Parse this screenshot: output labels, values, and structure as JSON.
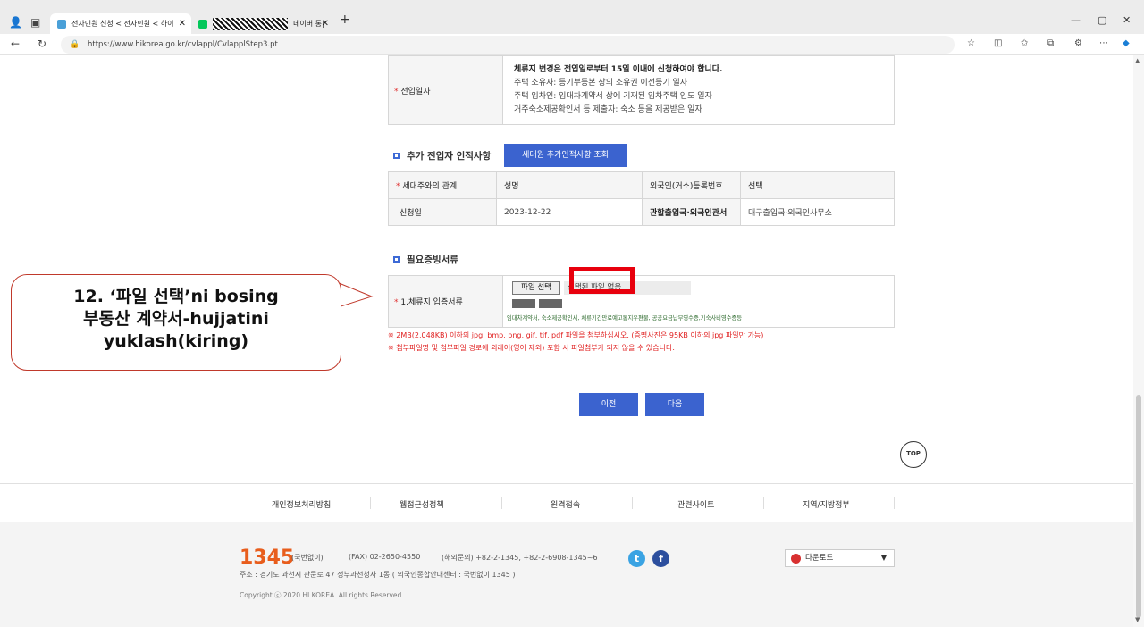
{
  "browser": {
    "tabs": [
      {
        "label": "전자민원 신청 < 전자민원 < 하이"
      },
      {
        "label": "네이버 통|"
      }
    ],
    "url": "https://www.hikorea.go.kr/cvlappl/CvlapplStep3.pt",
    "new_tab": "+",
    "win_min": "—",
    "win_max": "▢",
    "win_close": "✕"
  },
  "move_in": {
    "label": "전입일자",
    "bold_line": "체류지 변경은 전입일로부터 15일 이내에 신청하여야 합니다.",
    "lines": [
      "주택 소유자: 등기부등본 상의 소유권 이전등기 일자",
      "주택 임차인: 임대차계약서 상에 기재된 임차주택 인도 일자",
      "거주숙소제공확인서 등 제출자: 숙소 등을 제공받은 일자"
    ]
  },
  "additional": {
    "title": "추가 전입자 인적사항",
    "button": "세대원 추가인적사항 조회",
    "headers": [
      "세대주와의 관계",
      "성명",
      "외국인(거소)등록번호",
      "선택"
    ],
    "row": [
      "신청일",
      "2023-12-22",
      "관할출입국·외국인관서",
      "대구출입국·외국인사무소"
    ]
  },
  "documents": {
    "title": "필요증빙서류",
    "label": "1.체류지 입증서류",
    "file_button": "파일 선택",
    "file_status": "선택된 파일 없음",
    "hint": "임대차계약서, 숙소제공확인서, 체류기간만료예고통지우편물, 공공요금납부영수증,기숙사비영수증등",
    "notice1": "※ 2MB(2,048KB) 이하의 jpg, bmp, png, gif, tif, pdf 파일을 첨부하십시오. (증명사진은 95KB 이하의 jpg 파일만 가능)",
    "notice2": "※ 첨부파일명 및 첨부파일 경로에 외래어(영어 제외) 포함 시 파일첨부가 되지 않을 수 있습니다."
  },
  "callout": {
    "line1": "12. ‘파일 선택’ni bosing",
    "line2": "부동산 계약서-hujjatini",
    "line3": "yuklash(kiring)"
  },
  "nav": {
    "prev": "이전",
    "next": "다음",
    "top": "TOP"
  },
  "footer_links": [
    "개인정보처리방침",
    "웹접근성정책",
    "원격접속",
    "관련사이트",
    "지역/지방정부"
  ],
  "footer": {
    "phone": "1345",
    "phone_note": "(국번없이)",
    "fax": "(FAX) 02-2650-4550",
    "overseas": "(해외문의) +82-2-1345, +82-2-6908-1345~6",
    "address": "주소 : 경기도 과천시 관문로 47 정부과천청사 1동 ( 외국인종합안내센터 : 국번없이 1345 )",
    "copyright": "Copyright ⓒ 2020 HI KOREA. All rights Reserved.",
    "download": "다운로드"
  },
  "colors": {
    "accent": "#3b63cf",
    "highlight": "#e8000d",
    "phone": "#e85d1c"
  }
}
